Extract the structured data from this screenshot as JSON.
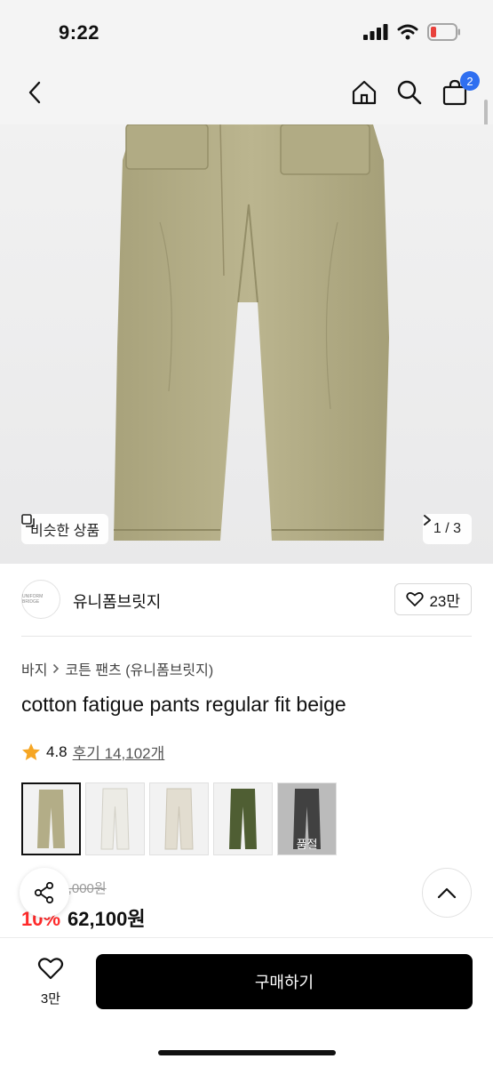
{
  "status": {
    "time": "9:22"
  },
  "nav": {
    "cart_count": "2"
  },
  "hero": {
    "similar_label": "비슷한 상품",
    "pager": "1 / 3"
  },
  "seller": {
    "name": "유니폼브릿지",
    "logo_text": "UNIFORM BRIDGE",
    "likes": "23만"
  },
  "breadcrumb": {
    "level1": "바지",
    "level2": "코튼 팬츠 (유니폼브릿지)"
  },
  "product": {
    "title": "cotton fatigue pants regular fit beige",
    "rating": "4.8",
    "reviews": "후기 14,102개"
  },
  "swatches": [
    {
      "color": "#b3ad87",
      "selected": true
    },
    {
      "color": "#ecebe5"
    },
    {
      "color": "#e2ddd0"
    },
    {
      "color": "#4f5e33"
    },
    {
      "color": "#151515",
      "soldout_label": "품절"
    }
  ],
  "price": {
    "original": "69,000원",
    "discount": "10%",
    "sale": "62,100원"
  },
  "bottom": {
    "wish_count": "3만",
    "buy_label": "구매하기"
  },
  "colors": {
    "accent_blue": "#2f6ff0",
    "discount_red": "#ff2a2a",
    "star": "#f6a623"
  }
}
